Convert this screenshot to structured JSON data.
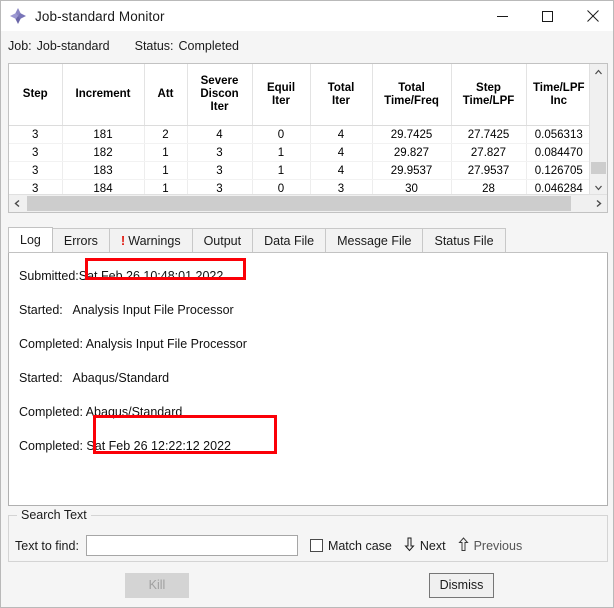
{
  "window": {
    "title": "Job-standard Monitor",
    "icon": "abaqus-diamond-icon",
    "minimize_label": "—",
    "maximize_label": "□",
    "close_label": "✕"
  },
  "status_line": {
    "job_label": "Job:",
    "job_value": "Job-standard",
    "status_label": "Status:",
    "status_value": "Completed"
  },
  "table": {
    "columns": [
      "Step",
      "Increment",
      "Att",
      "Severe\nDiscon\nIter",
      "Equil\nIter",
      "Total\nIter",
      "Total\nTime/Freq",
      "Step\nTime/LPF",
      "Time/LPF\nInc"
    ],
    "rows": [
      [
        "3",
        "181",
        "2",
        "4",
        "0",
        "4",
        "29.7425",
        "27.7425",
        "0.056313"
      ],
      [
        "3",
        "182",
        "1",
        "3",
        "1",
        "4",
        "29.827",
        "27.827",
        "0.084470"
      ],
      [
        "3",
        "183",
        "1",
        "3",
        "1",
        "4",
        "29.9537",
        "27.9537",
        "0.126705"
      ],
      [
        "3",
        "184",
        "1",
        "3",
        "0",
        "3",
        "30",
        "28",
        "0.046284"
      ]
    ],
    "scroll_up_icon": "chevron-up-icon",
    "scroll_down_icon": "chevron-down-icon",
    "scroll_left_icon": "chevron-left-icon",
    "scroll_right_icon": "chevron-right-icon"
  },
  "tabs": [
    {
      "label": "Log",
      "active": true,
      "warn": false
    },
    {
      "label": "Errors",
      "active": false,
      "warn": false
    },
    {
      "label": "Warnings",
      "active": false,
      "warn": true,
      "warn_glyph": "!"
    },
    {
      "label": "Output",
      "active": false,
      "warn": false
    },
    {
      "label": "Data File",
      "active": false,
      "warn": false
    },
    {
      "label": "Message File",
      "active": false,
      "warn": false
    },
    {
      "label": "Status File",
      "active": false,
      "warn": false
    }
  ],
  "log": {
    "lines": [
      {
        "key": "Submitted:",
        "value": "Sat Feb 26 10:48:01 2022"
      },
      {
        "key": "Started:",
        "value": "   Analysis Input File Processor"
      },
      {
        "key": "Completed:",
        "value": " Analysis Input File Processor"
      },
      {
        "key": "Started:",
        "value": "   Abaqus/Standard"
      },
      {
        "key": "Completed:",
        "value": " Abaqus/Standard"
      },
      {
        "key": "Completed:",
        "value": " Sat Feb 26 12:22:12 2022"
      }
    ],
    "highlight_color": "#fb0007"
  },
  "search": {
    "legend": "Search Text",
    "find_label": "Text to find:",
    "find_value": "",
    "find_placeholder": "",
    "match_case_label": "Match case",
    "match_case_checked": false,
    "next_label": "Next",
    "next_icon": "arrow-down-icon",
    "previous_label": "Previous",
    "previous_icon": "arrow-up-icon"
  },
  "footer": {
    "kill_label": "Kill",
    "kill_enabled": false,
    "dismiss_label": "Dismiss",
    "dismiss_enabled": true
  }
}
